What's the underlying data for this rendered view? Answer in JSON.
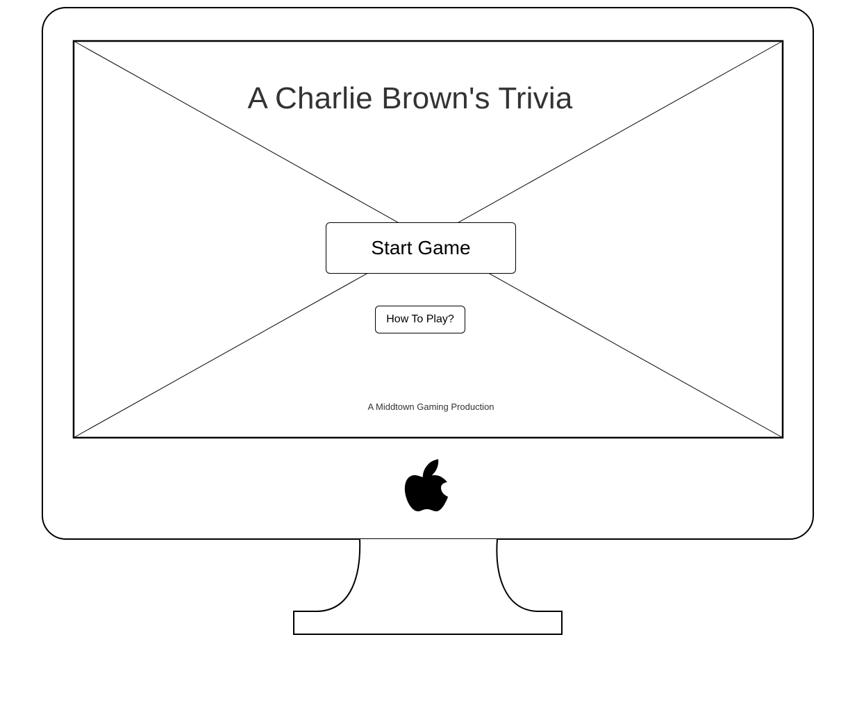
{
  "screen": {
    "title": "A Charlie Brown's Trivia",
    "start_button_label": "Start Game",
    "how_to_play_label": "How To Play?",
    "footer_credit": "A Middtown Gaming Production"
  },
  "monitor": {
    "logo_icon": "apple-logo-icon",
    "frame_color": "#000000",
    "background_color": "#ffffff"
  }
}
